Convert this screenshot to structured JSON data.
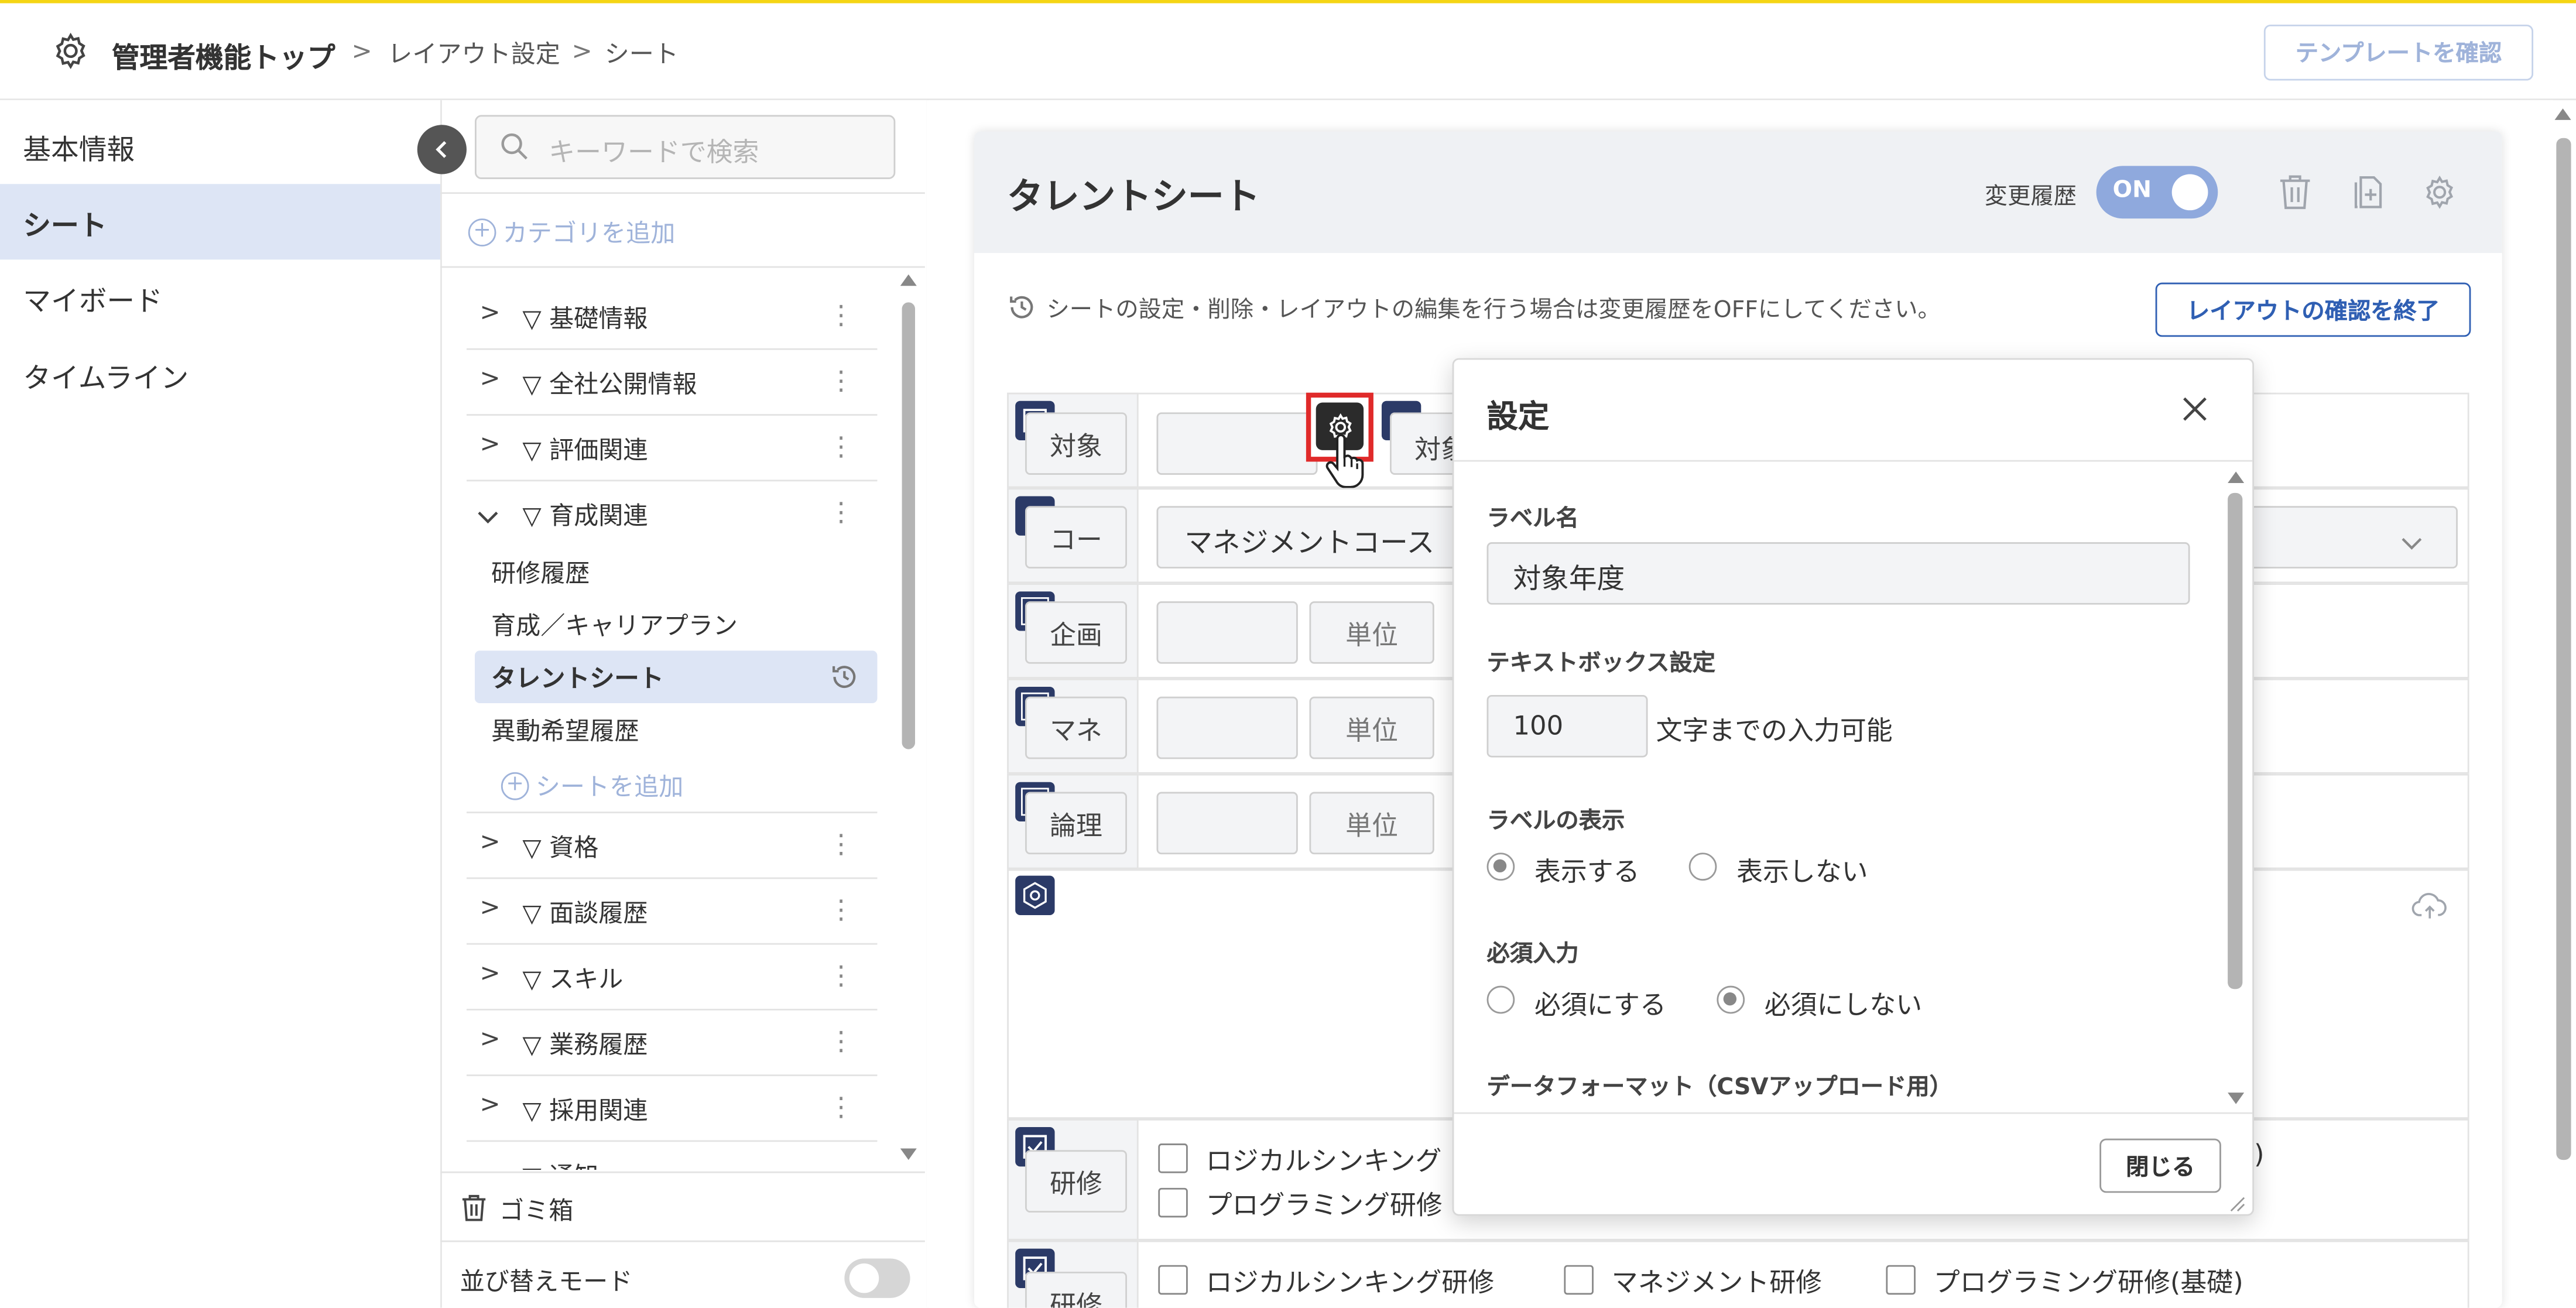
{
  "header": {
    "breadcrumb_top": "管理者機能トップ",
    "breadcrumb_layout": "レイアウト設定",
    "breadcrumb_sheet": "シート",
    "template_button": "テンプレートを確認"
  },
  "leftnav": {
    "items": [
      {
        "label": "基本情報"
      },
      {
        "label": "シート"
      },
      {
        "label": "マイボード"
      },
      {
        "label": "タイムライン"
      }
    ]
  },
  "categories": {
    "search_placeholder": "キーワードで検索",
    "add_category": "カテゴリを追加",
    "items": [
      {
        "label": "▽ 基礎情報"
      },
      {
        "label": "▽ 全社公開情報"
      },
      {
        "label": "▽ 評価関連"
      },
      {
        "label": "▽ 育成関連"
      },
      {
        "label": "▽ 資格"
      },
      {
        "label": "▽ 面談履歴"
      },
      {
        "label": "▽ スキル"
      },
      {
        "label": "▽ 業務履歴"
      },
      {
        "label": "▽ 採用関連"
      },
      {
        "label": "▽ 通知"
      }
    ],
    "sheets": [
      {
        "label": "研修履歴"
      },
      {
        "label": "育成／キャリアプラン"
      },
      {
        "label": "タレントシート"
      },
      {
        "label": "異動希望履歴"
      }
    ],
    "add_sheet": "シートを追加",
    "trash": "ゴミ箱",
    "sort_mode": "並び替えモード"
  },
  "sheet": {
    "title": "タレントシート",
    "history_label": "変更履歴",
    "history_toggle": "ON",
    "notice": "シートの設定・削除・レイアウトの編集を行う場合は変更履歴をOFFにしてください。",
    "end_confirm_button": "レイアウトの確認を終了",
    "fields": [
      {
        "label": "対象",
        "extra": "対象"
      },
      {
        "label": "コー",
        "value": "マネジメントコース"
      },
      {
        "label": "企画",
        "unit": "単位"
      },
      {
        "label": "マネ",
        "unit": "単位"
      },
      {
        "label": "論理",
        "unit": "単位"
      }
    ],
    "check_label_1": "研修",
    "check_label_2": "研修",
    "checks_row1": [
      "ロジカルシンキング",
      "プログラミング研修"
    ],
    "checks_row1_tail": ")",
    "checks_row2": [
      "ロジカルシンキング研修",
      "マネジメント研修",
      "プログラミング研修(基礎)"
    ]
  },
  "modal": {
    "title": "設定",
    "label_name_heading": "ラベル名",
    "label_name_value": "対象年度",
    "textbox_heading": "テキストボックス設定",
    "textbox_value": "100",
    "textbox_suffix": "文字までの入力可能",
    "label_display_heading": "ラベルの表示",
    "label_display_options": [
      "表示する",
      "表示しない"
    ],
    "label_display_selected": "表示する",
    "required_heading": "必須入力",
    "required_options": [
      "必須にする",
      "必須にしない"
    ],
    "required_selected": "必須にしない",
    "format_heading": "データフォーマット（CSVアップロード用）",
    "close_button": "閉じる"
  },
  "colors": {
    "accent": "#2f5fb3",
    "nav_active": "#dde5f5",
    "top_line": "#f5d514",
    "highlight": "#e02a2a",
    "icon_dark": "#2b3a67"
  }
}
